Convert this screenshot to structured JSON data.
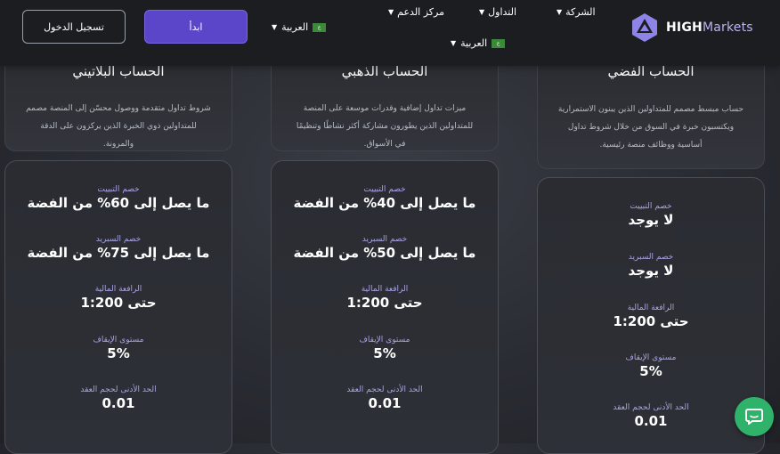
{
  "header": {
    "login_label": "تسجيل الدخول",
    "start_label": "ابدأ",
    "lang_label": "العربية",
    "flag_text": "ع",
    "nav": {
      "support": "مركز الدعم",
      "trading": "التداول",
      "company": "الشركة"
    },
    "logo_bold": "HIGH",
    "logo_light": "Markets"
  },
  "accounts": [
    {
      "title": "الحساب البلاتيني",
      "description": "شروط تداول متقدمة ووصول محسّن إلى المنصة مصمم للمتداولين ذوي الخبرة الذين يركزون على الدقة والمرونة.",
      "stats": [
        {
          "label": "خصم التبييت",
          "value": "ما يصل إلى 60% من الفضة"
        },
        {
          "label": "خصم السبريد",
          "value": "ما يصل إلى 75% من الفضة"
        },
        {
          "label": "الرافعة المالية",
          "value": "حتى 1:200"
        },
        {
          "label": "مستوى الإيقاف",
          "value": "5%"
        },
        {
          "label": "الحد الأدنى لحجم العقد",
          "value": "0.01"
        }
      ]
    },
    {
      "title": "الحساب الذهبي",
      "description": "ميزات تداول إضافية وقدرات موسعة على المنصة للمتداولين الذين يطورون مشاركة أكثر نشاطًا وتنظيمًا في الأسواق.",
      "stats": [
        {
          "label": "خصم التبييت",
          "value": "ما يصل إلى 40% من الفضة"
        },
        {
          "label": "خصم السبريد",
          "value": "ما يصل إلى 50% من الفضة"
        },
        {
          "label": "الرافعة المالية",
          "value": "حتى 1:200"
        },
        {
          "label": "مستوى الإيقاف",
          "value": "5%"
        },
        {
          "label": "الحد الأدنى لحجم العقد",
          "value": "0.01"
        }
      ]
    },
    {
      "title": "الحساب الفضي",
      "description": "حساب مبسط مصمم للمتداولين الذين يبنون الاستمرارية ويكتسبون خبرة في السوق من خلال شروط تداول أساسية ووظائف منصة رئيسية.",
      "stats": [
        {
          "label": "خصم التبييت",
          "value": "لا يوجد"
        },
        {
          "label": "خصم السبريد",
          "value": "لا يوجد"
        },
        {
          "label": "الرافعة المالية",
          "value": "حتى 1:200"
        },
        {
          "label": "مستوى الإيقاف",
          "value": "5%"
        },
        {
          "label": "الحد الأدنى لحجم العقد",
          "value": "0.01"
        }
      ]
    }
  ],
  "colors": {
    "accent": "#5b45c8",
    "label_purple": "#a9a4e6",
    "chat_green": "#2fb36a"
  },
  "icons": {
    "logo": "highmarkets-logo-icon",
    "chat": "chat-icon"
  }
}
